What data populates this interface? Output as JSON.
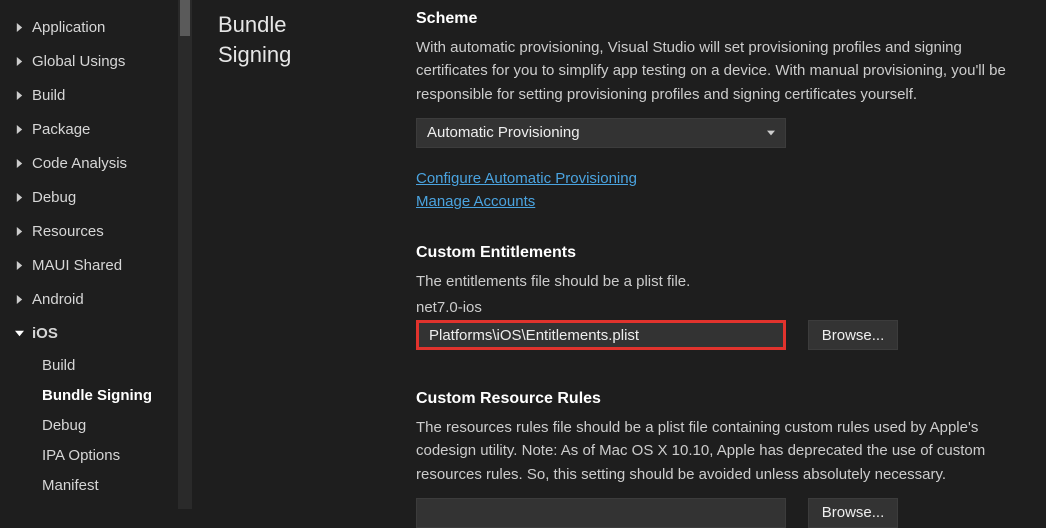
{
  "sidebar": {
    "items": [
      {
        "label": "Application"
      },
      {
        "label": "Global Usings"
      },
      {
        "label": "Build"
      },
      {
        "label": "Package"
      },
      {
        "label": "Code Analysis"
      },
      {
        "label": "Debug"
      },
      {
        "label": "Resources"
      },
      {
        "label": "MAUI Shared"
      },
      {
        "label": "Android"
      }
    ],
    "expandedLabel": "iOS",
    "subitems": [
      {
        "label": "Build"
      },
      {
        "label": "Bundle Signing"
      },
      {
        "label": "Debug"
      },
      {
        "label": "IPA Options"
      },
      {
        "label": "Manifest"
      }
    ]
  },
  "heading": {
    "line1": "Bundle",
    "line2": "Signing"
  },
  "scheme": {
    "title": "Scheme",
    "description": "With automatic provisioning, Visual Studio will set provisioning profiles and signing certificates for you to simplify app testing on a device. With manual provisioning, you'll be responsible for setting provisioning profiles and signing certificates yourself.",
    "dropdownValue": "Automatic Provisioning",
    "link1": "Configure Automatic Provisioning",
    "link2": "Manage Accounts"
  },
  "entitlements": {
    "title": "Custom Entitlements",
    "description": "The entitlements file should be a plist file.",
    "framework": "net7.0-ios",
    "path": "Platforms\\iOS\\Entitlements.plist",
    "browseLabel": "Browse..."
  },
  "resourceRules": {
    "title": "Custom Resource Rules",
    "description": "The resources rules file should be a plist file containing custom rules used by Apple's codesign utility. Note: As of Mac OS X 10.10, Apple has deprecated the use of custom resources rules. So, this setting should be avoided unless absolutely necessary.",
    "path": "",
    "browseLabel": "Browse..."
  }
}
